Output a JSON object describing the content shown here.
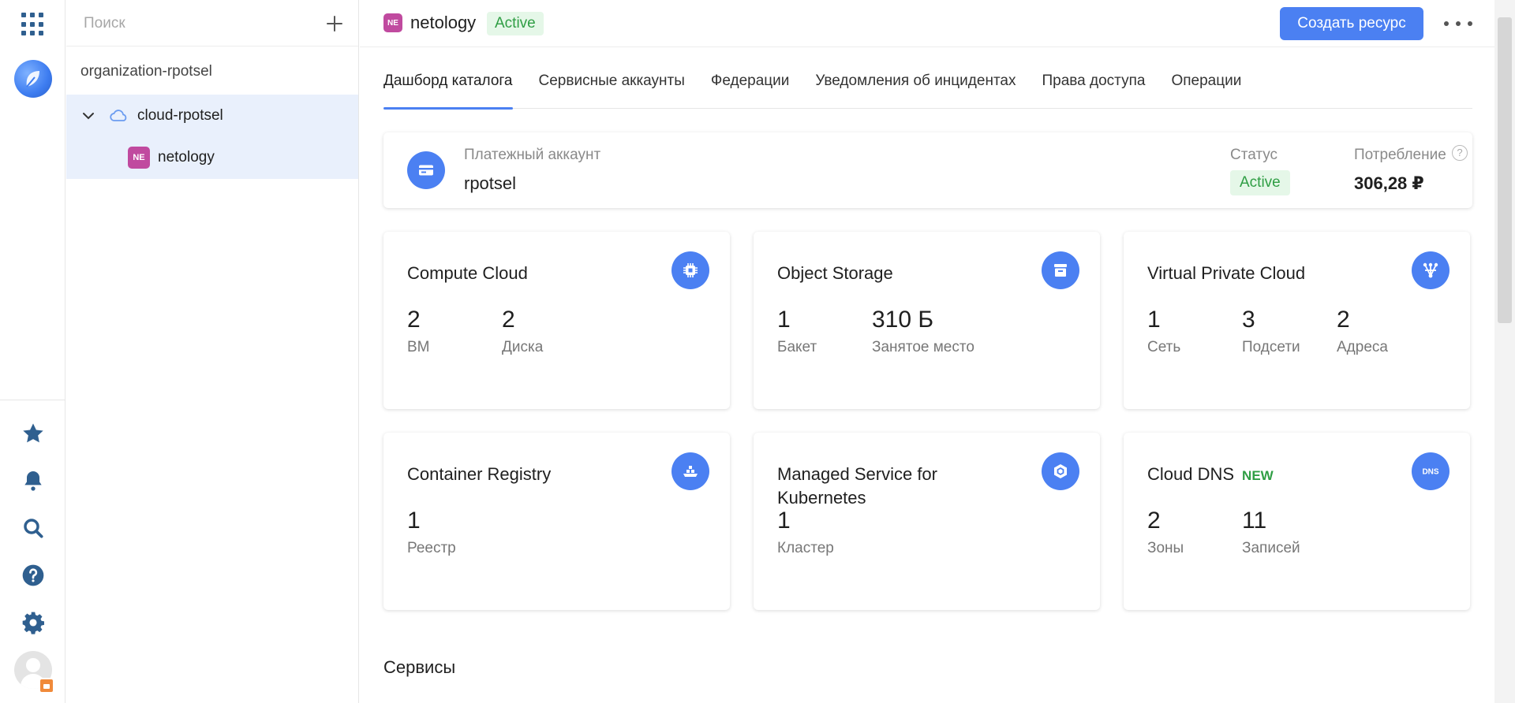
{
  "rail": {
    "icons": [
      "apps-grid-icon",
      "cloud-logo-icon",
      "star-icon",
      "bell-icon",
      "search-icon",
      "help-icon",
      "gear-icon",
      "avatar"
    ]
  },
  "tree": {
    "search": {
      "placeholder": "Поиск",
      "value": ""
    },
    "organization": "organization-rpotsel",
    "cloud": "cloud-rpotsel",
    "folder": {
      "badge": "NE",
      "label": "netology"
    }
  },
  "header": {
    "badge": "NE",
    "title": "netology",
    "status": "Active",
    "create_button": "Создать ресурс"
  },
  "tabs": [
    {
      "label": "Дашборд каталога",
      "active": true
    },
    {
      "label": "Сервисные аккаунты",
      "active": false
    },
    {
      "label": "Федерации",
      "active": false
    },
    {
      "label": "Уведомления об инцидентах",
      "active": false
    },
    {
      "label": "Права доступа",
      "active": false
    },
    {
      "label": "Операции",
      "active": false
    }
  ],
  "billing": {
    "label": "Платежный аккаунт",
    "name": "rpotsel",
    "status_label": "Статус",
    "status": "Active",
    "consumption_label": "Потребление",
    "help": "?",
    "consumption": "306,28 ₽"
  },
  "cards": [
    {
      "title": "Compute Cloud",
      "icon": "chip-icon",
      "new": "",
      "metrics": [
        {
          "value": "2",
          "label": "ВМ"
        },
        {
          "value": "2",
          "label": "Диска"
        }
      ]
    },
    {
      "title": "Object Storage",
      "icon": "storage-icon",
      "new": "",
      "metrics": [
        {
          "value": "1",
          "label": "Бакет"
        },
        {
          "value": "310 Б",
          "label": "Занятое место"
        }
      ]
    },
    {
      "title": "Virtual Private Cloud",
      "icon": "network-icon",
      "new": "",
      "metrics": [
        {
          "value": "1",
          "label": "Сеть"
        },
        {
          "value": "3",
          "label": "Подсети"
        },
        {
          "value": "2",
          "label": "Адреса"
        }
      ]
    },
    {
      "title": "Container Registry",
      "icon": "registry-icon",
      "new": "",
      "metrics": [
        {
          "value": "1",
          "label": "Реестр"
        }
      ]
    },
    {
      "title": "Managed Service for Kubernetes",
      "icon": "kubernetes-icon",
      "new": "",
      "metrics": [
        {
          "value": "1",
          "label": "Кластер"
        }
      ]
    },
    {
      "title": "Cloud DNS",
      "icon": "dns-icon",
      "new": "NEW",
      "icon_text": "DNS",
      "metrics": [
        {
          "value": "2",
          "label": "Зоны"
        },
        {
          "value": "11",
          "label": "Записей"
        }
      ]
    }
  ],
  "sections": {
    "services": "Сервисы"
  },
  "colors": {
    "accent": "#4b80f2",
    "active_bg": "#e5f7e8",
    "active_text": "#2f9e44",
    "folder_badge": "#c04a9f",
    "selected_row": "#e9f0fc"
  }
}
